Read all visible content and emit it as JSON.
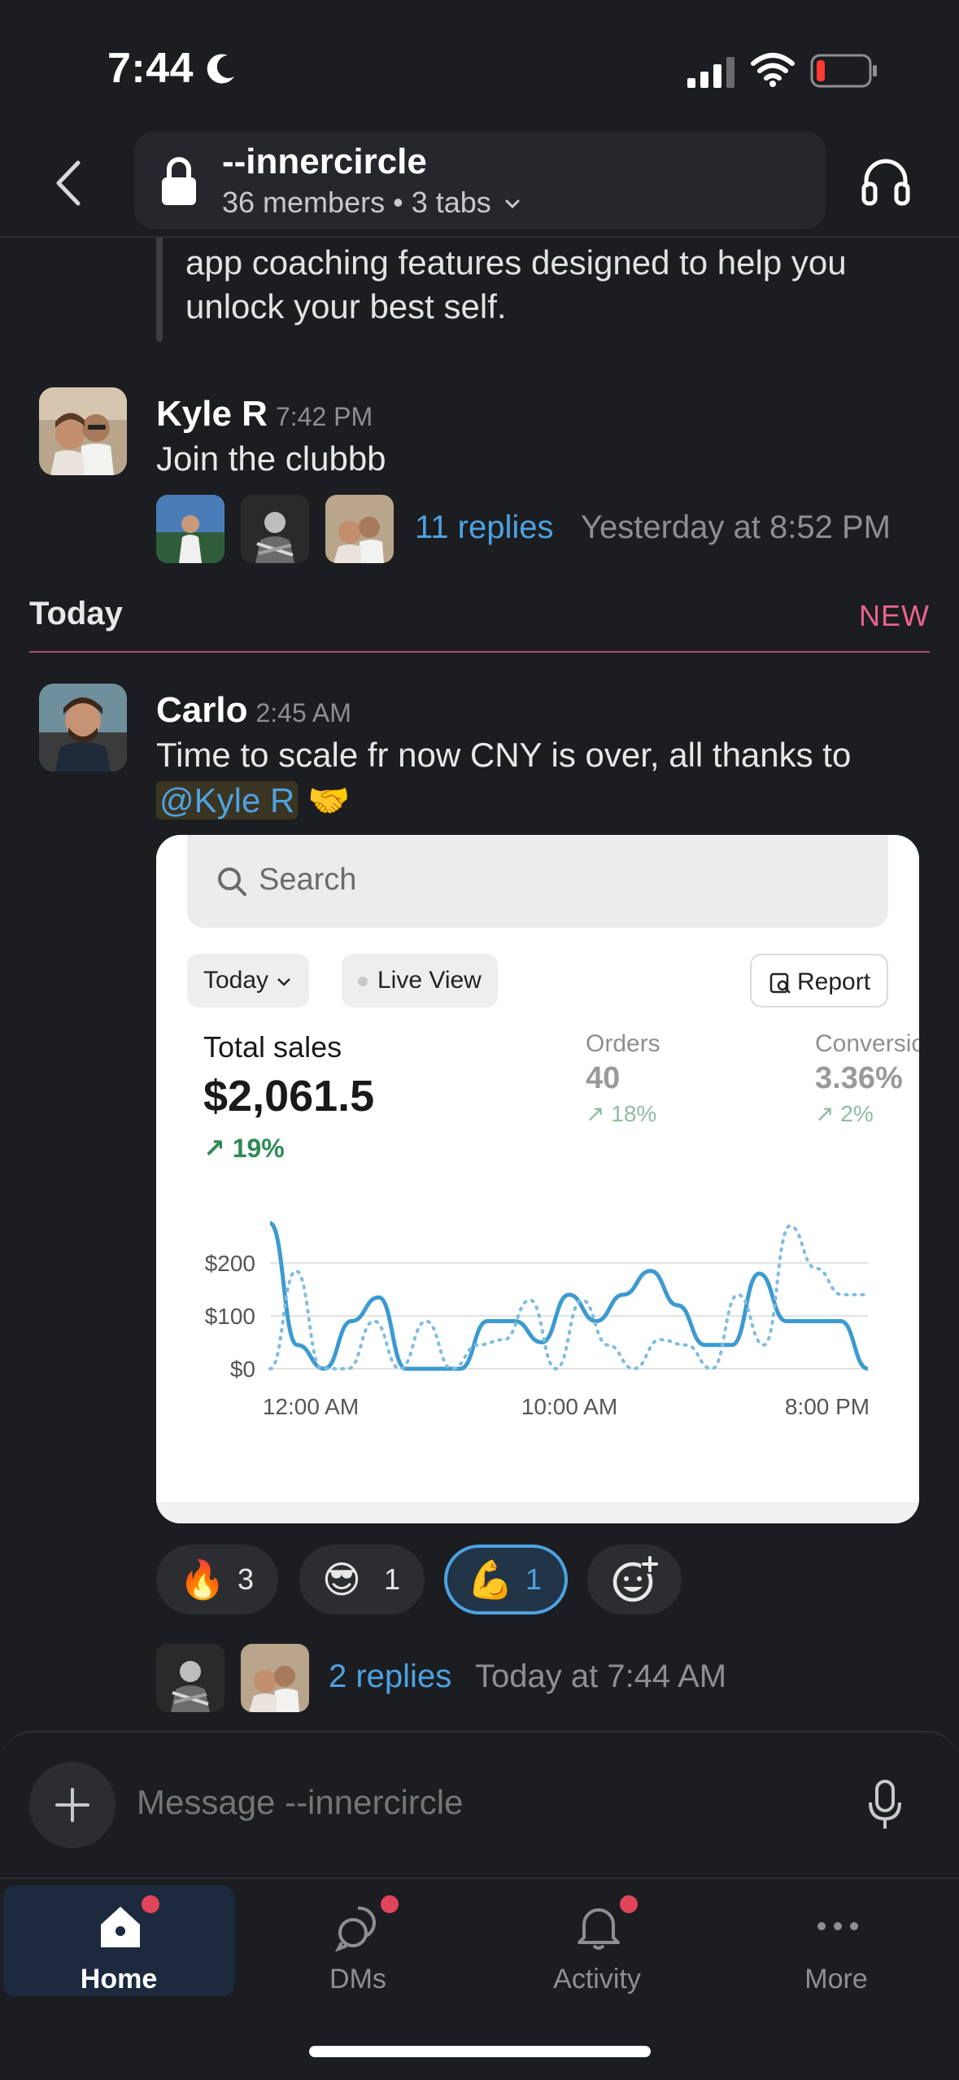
{
  "status_bar": {
    "time": "7:44"
  },
  "header": {
    "channel_name": "--innercircle",
    "members": "36 members",
    "separator": "•",
    "tabs": "3 tabs"
  },
  "feed": {
    "quoted_text": "body's recovery, strain, sleep, and health with in-app coaching features designed to help you unlock your best self.",
    "messages": [
      {
        "author": "Kyle R",
        "time": "7:42 PM",
        "text": "Join the clubbb",
        "replies": "11 replies",
        "reply_time": "Yesterday at 8:52 PM"
      },
      {
        "author": "Carlo",
        "time": "2:45 AM",
        "text": "Time to scale fr now CNY is over, all thanks to ",
        "mention": "@Kyle R",
        "emoji": "🤝",
        "replies": "2 replies",
        "reply_time": "Today at 7:44 AM"
      }
    ],
    "divider": {
      "label": "Today",
      "new_label": "NEW"
    },
    "reactions": [
      {
        "emoji": "🔥",
        "count": "3",
        "active": false
      },
      {
        "emoji": "😎",
        "count": "1",
        "active": false
      },
      {
        "emoji": "💪",
        "count": "1",
        "active": true
      }
    ]
  },
  "embed": {
    "search_placeholder": "Search",
    "filter_today": "Today",
    "live_view": "Live View",
    "report": "Report",
    "total_sales_label": "Total sales",
    "total_sales_value": "$2,061.5",
    "total_sales_delta": "↗ 19%",
    "orders_label": "Orders",
    "orders_value": "40",
    "orders_delta": "↗ 18%",
    "conversion_label": "Conversion",
    "conversion_value": "3.36%",
    "conversion_delta": "↗ 2%"
  },
  "chart_data": {
    "type": "line",
    "y_ticks": [
      "$200",
      "$100",
      "$0"
    ],
    "x_ticks": [
      "12:00 AM",
      "10:00 AM",
      "8:00 PM"
    ],
    "ylim": [
      0,
      280
    ],
    "series": [
      {
        "values": [
          275,
          45,
          0,
          90,
          135,
          0,
          0,
          0,
          90,
          90,
          50,
          140,
          90,
          140,
          185,
          120,
          45,
          45,
          180,
          90,
          90,
          90,
          0
        ],
        "style": "solid",
        "color": "#3c9ad0"
      },
      {
        "values": [
          0,
          185,
          0,
          0,
          90,
          0,
          90,
          0,
          45,
          55,
          130,
          0,
          130,
          45,
          0,
          55,
          45,
          0,
          140,
          45,
          270,
          190,
          140,
          140
        ],
        "style": "dotted",
        "color": "#7fbde0"
      }
    ]
  },
  "composer": {
    "placeholder": "Message --innercircle"
  },
  "tabbar": {
    "items": [
      {
        "label": "Home",
        "active": true
      },
      {
        "label": "DMs",
        "active": false
      },
      {
        "label": "Activity",
        "active": false
      },
      {
        "label": "More",
        "active": false
      }
    ]
  }
}
